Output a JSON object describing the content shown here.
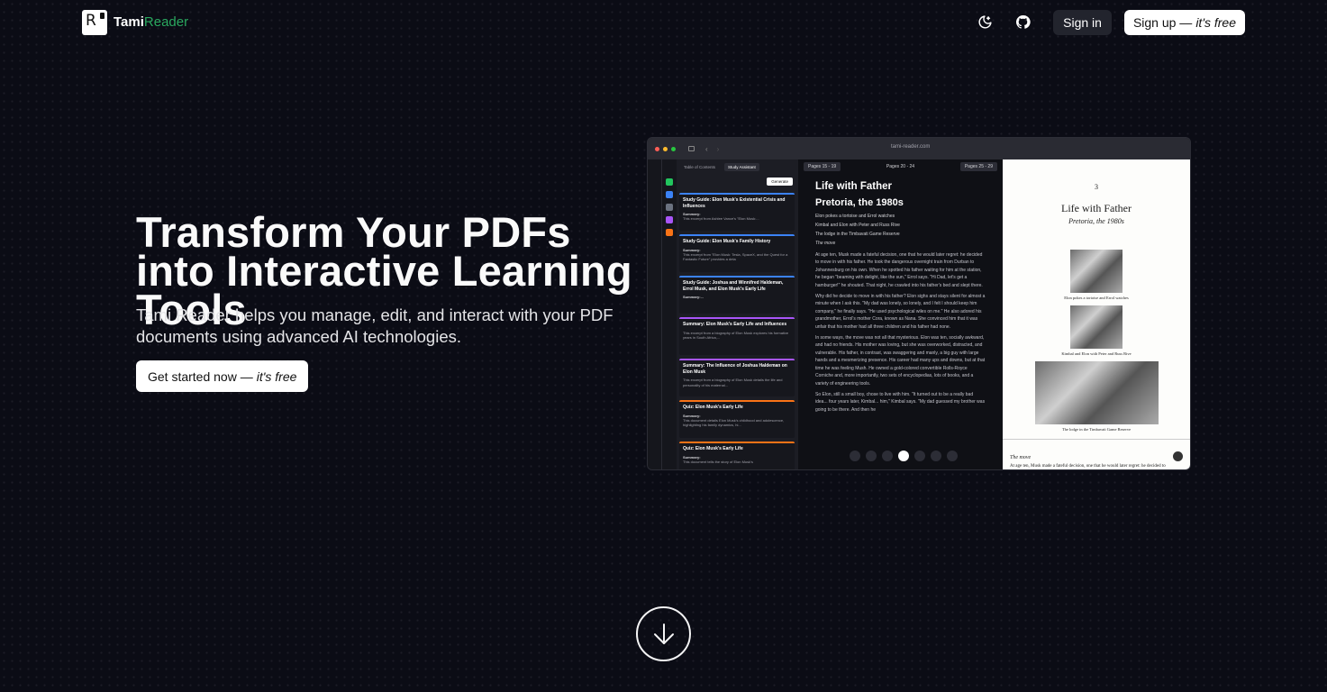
{
  "brand": {
    "name_main": "Tami",
    "name_accent": "Reader",
    "logo_letter": "R"
  },
  "nav": {
    "signin_label": "Sign in",
    "signup_label": "Sign up —",
    "signup_suffix": "it's free"
  },
  "hero": {
    "title": "Transform Your PDFs into Interactive Learning Tools",
    "subtitle": "Tami Reader helps you manage, edit, and interact with your PDF documents using advanced AI technologies.",
    "cta_label": "Get started now —",
    "cta_suffix": "it's free"
  },
  "screenshot": {
    "url": "tami-reader.com",
    "tabs": [
      "Table of Contents",
      "Study Assistant"
    ],
    "generate_label": "Generate",
    "cards": [
      {
        "title": "Study Guide: Elon Musk's Existential Crisis and Influences",
        "summary_label": "Summary:",
        "text": "This excerpt from Ashlee Vance's \"Elon Musk:...",
        "accent": "#3b82f6"
      },
      {
        "title": "Study Guide: Elon Musk's Family History",
        "summary_label": "Summary:",
        "text": "This excerpt from \"Elon Musk: Tesla, SpaceX, and the Quest for a Fantastic Future\" provides a deta",
        "accent": "#3b82f6"
      },
      {
        "title": "Study Guide: Joshua and Winnifred Haldeman, Errol Musk, and Elon Musk's Early Life",
        "summary_label": "Summary:...",
        "text": "",
        "accent": "#3b82f6"
      },
      {
        "title": "Summary: Elon Musk's Early Life and Influences",
        "summary_label": "",
        "text": "This excerpt from a biography of Elon Musk explores his formative years in South Africa,...",
        "accent": "#a855f7"
      },
      {
        "title": "Summary: The Influence of Joshua Haldeman on Elon Musk",
        "summary_label": "",
        "text": "This excerpt from a biography of Elon Musk details the life and personality of his maternal...",
        "accent": "#a855f7"
      },
      {
        "title": "Quiz: Elon Musk's Early Life",
        "summary_label": "Summary:",
        "text": "This document details Elon Musk's childhood and adolescence, highlighting his family dynamics, hi...",
        "accent": "#f97316"
      },
      {
        "title": "Quiz: Elon Musk's Early Life",
        "summary_label": "Summary:",
        "text": "This document tells the story of Elon Musk's",
        "accent": "#f97316"
      }
    ],
    "reader": {
      "prev_pages": "Pages 15 - 19",
      "current_pages": "Pages 20 - 24",
      "next_pages": "Pages 25 - 29",
      "heading": "Life with Father",
      "subheading": "Pretoria, the 1980s",
      "lines": [
        "Elon pokes a tortoise and Errol watches",
        "Kimbal and Elon with Peter and Russ Rive",
        "The lodge in the Timbavati Game Reserve",
        "The move"
      ],
      "paragraphs": [
        "At age ten, Musk made a fateful decision, one that he would later regret: he decided to move in with his father. He took the dangerous overnight train from Durban to Johannesburg on his own. When he spotted his father waiting for him at the station, he began \"beaming with delight, like the sun,\" Errol says. \"Hi Dad, let's get a hamburger!\" he shouted. That night, he crawled into his father's bed and slept there.",
        "Why did he decide to move in with his father? Elon sighs and stays silent for almost a minute when I ask this. \"My dad was lonely, so lonely, and I felt I should keep him company,\" he finally says. \"He used psychological wiles on me.\" He also adored his grandmother, Errol's mother Cora, known as Nana. She convinced him that it was unfair that his mother had all three children and his father had none.",
        "In some ways, the move was not all that mysterious. Elon was ten, socially awkward, and had no friends. His mother was loving, but she was overworked, distracted, and vulnerable. His father, in contrast, was swaggering and manly, a big guy with large hands and a mesmerizing presence. His career had many ups and downs, but at that time he was feeling Mush. He owned a gold-colored convertible Rolls-Royce Corniche and, more importantly, two sets of encyclopedias, lots of books, and a variety of engineering tools.",
        "So Elon, still a small boy, chose to live with him. \"It turned out to be a really bad idea... four years later, Kimbal... him,\" Kimbal says. \"My dad guessed my brother was going to be there. And then he"
      ]
    },
    "page": {
      "number": "3",
      "title": "Life with Father",
      "subtitle": "Pretoria, the 1980s",
      "captions": [
        "Elon pokes a tortoise and Errol watches",
        "Kimbal and Elon with Peter and Russ Rive",
        "The lodge in the Timbavati Game Reserve"
      ],
      "section": "The move",
      "footer_text": "At age ten, Musk made a fateful decision, one that he would later regret: he decided to"
    }
  },
  "colors": {
    "background": "#0b0c15",
    "accent": "#2aa85f"
  },
  "icons": {
    "theme": "moon-icon",
    "github": "github-icon",
    "scroll": "arrow-down-icon"
  }
}
